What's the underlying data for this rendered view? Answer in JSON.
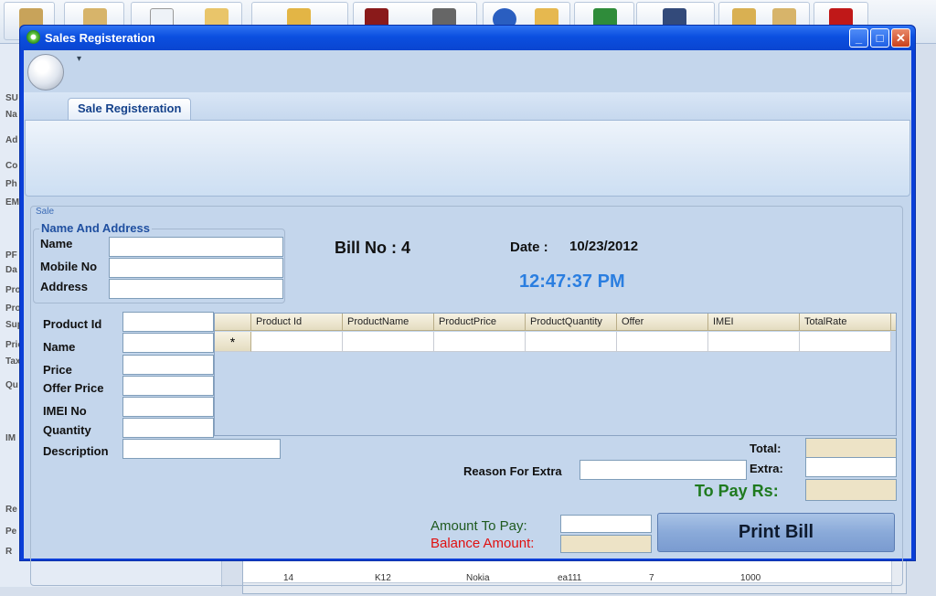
{
  "window": {
    "title": "Sales Registeration"
  },
  "ribbon": {
    "tab_label": "Sale Registeration"
  },
  "sale_group_label": "Sale",
  "name_address": {
    "legend": "Name And Address",
    "name_label": "Name",
    "mobile_label": "Mobile No",
    "address_label": "Address",
    "name_value": "",
    "mobile_value": "",
    "address_value": ""
  },
  "bill": {
    "text": "Bill No :  4"
  },
  "date": {
    "label": "Date :",
    "value": "10/23/2012"
  },
  "clock": {
    "value": "12:47:37 PM"
  },
  "product_form": {
    "product_id_label": "Product Id",
    "name_label": "Name",
    "price_label": "Price",
    "offer_price_label": "Offer Price",
    "imei_label": "IMEI No",
    "quantity_label": "Quantity",
    "description_label": "Description"
  },
  "grid": {
    "columns": [
      "Product Id",
      "ProductName",
      "ProductPrice",
      "ProductQuantity",
      "Offer",
      "IMEI",
      "TotalRate"
    ],
    "new_row_marker": "*"
  },
  "totals": {
    "total_label": "Total:",
    "reason_label": "Reason For Extra",
    "extra_label": "Extra:",
    "to_pay_label": "To Pay Rs:",
    "amount_to_pay_label": "Amount To Pay:",
    "balance_label": "Balance Amount:"
  },
  "actions": {
    "print_label": "Print Bill"
  },
  "background": {
    "left_labels": [
      "SU",
      "Na",
      "Ad",
      "Co",
      "Ph",
      "EM",
      "PF",
      "Da",
      "Pro",
      "Pro",
      "Sup",
      "Pric",
      "Tax",
      "Qu",
      "IM",
      "Re",
      "Pe",
      "R"
    ],
    "grid_row_top": [
      "14",
      "K12",
      "Nokia",
      "ea111",
      "7",
      "1000"
    ]
  },
  "colors": {
    "title_bar": "#0b4fe0",
    "clock": "#2a7ee0",
    "to_pay": "#1f7a1f",
    "balance": "#e01010"
  }
}
